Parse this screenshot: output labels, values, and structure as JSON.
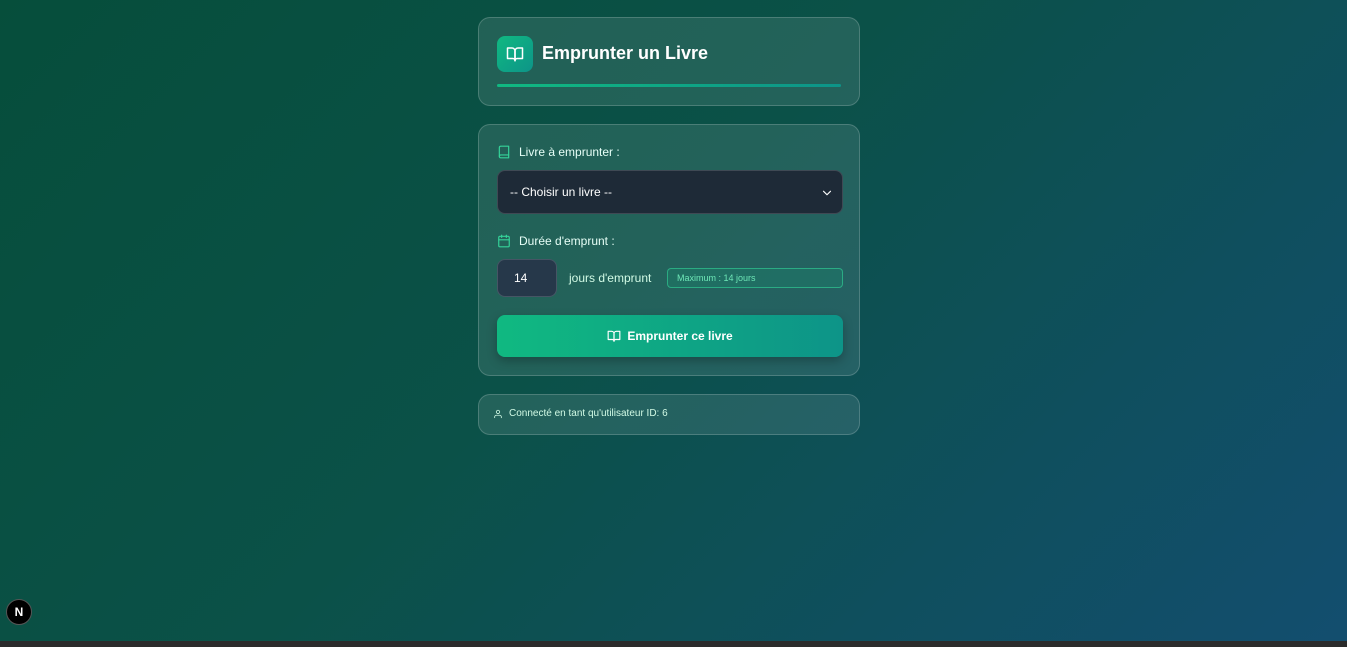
{
  "header": {
    "title": "Emprunter un Livre",
    "icon": "book-open-icon"
  },
  "form": {
    "book_label": "Livre à emprunter :",
    "book_select_value": "-- Choisir un livre --",
    "duration_label": "Durée d'emprunt :",
    "duration_value": "14",
    "duration_unit": "jours d'emprunt",
    "max_badge": "Maximum : 14 jours",
    "submit_label": "Emprunter ce livre"
  },
  "footer": {
    "user_info": "Connecté en tant qu'utilisateur ID: 6"
  },
  "dev_badge": {
    "label": "N"
  },
  "colors": {
    "accent": "#10b981",
    "accent_dark": "#0d9488",
    "select_bg": "#1e2a37"
  }
}
